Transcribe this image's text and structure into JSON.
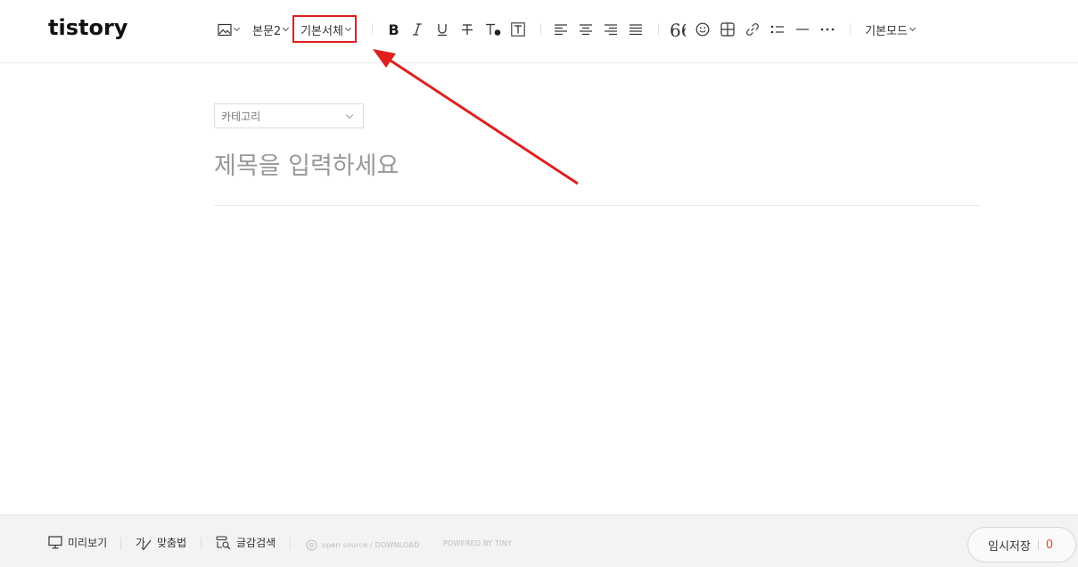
{
  "app": {
    "logo": "tistory"
  },
  "toolbar": {
    "image_icon": "image-icon",
    "paragraph_style": "본문2",
    "font_family": "기본서체",
    "bold_icon": "bold-icon",
    "italic_icon": "italic-icon",
    "underline_icon": "underline-icon",
    "strikethrough_icon": "strikethrough-icon",
    "text_color_icon": "text-color-icon",
    "background_color_icon": "text-background-icon",
    "align_left_icon": "align-left-icon",
    "align_center_icon": "align-center-icon",
    "align_right_icon": "align-right-icon",
    "align_justify_icon": "align-justify-icon",
    "quote_icon": "quote-icon",
    "emoticon_icon": "emoticon-icon",
    "table_icon": "table-icon",
    "link_icon": "link-icon",
    "list_icon": "list-icon",
    "horizontal_rule_icon": "horizontal-rule-icon",
    "more_icon": "more-icon",
    "mode": "기본모드"
  },
  "editor": {
    "category_label": "카테고리",
    "title_placeholder": "제목을 입력하세요",
    "title_value": ""
  },
  "footer": {
    "preview": "미리보기",
    "spellcheck": "맞춤법",
    "search_text": "글감검색",
    "open_source_link": "open source / DOWNLOAD",
    "powered_by": "POWERED BY TINY",
    "save_draft": "임시저장",
    "draft_count": "0"
  },
  "annotation": {
    "highlight_color": "#e01f1f",
    "target": "font-family-dropdown"
  }
}
